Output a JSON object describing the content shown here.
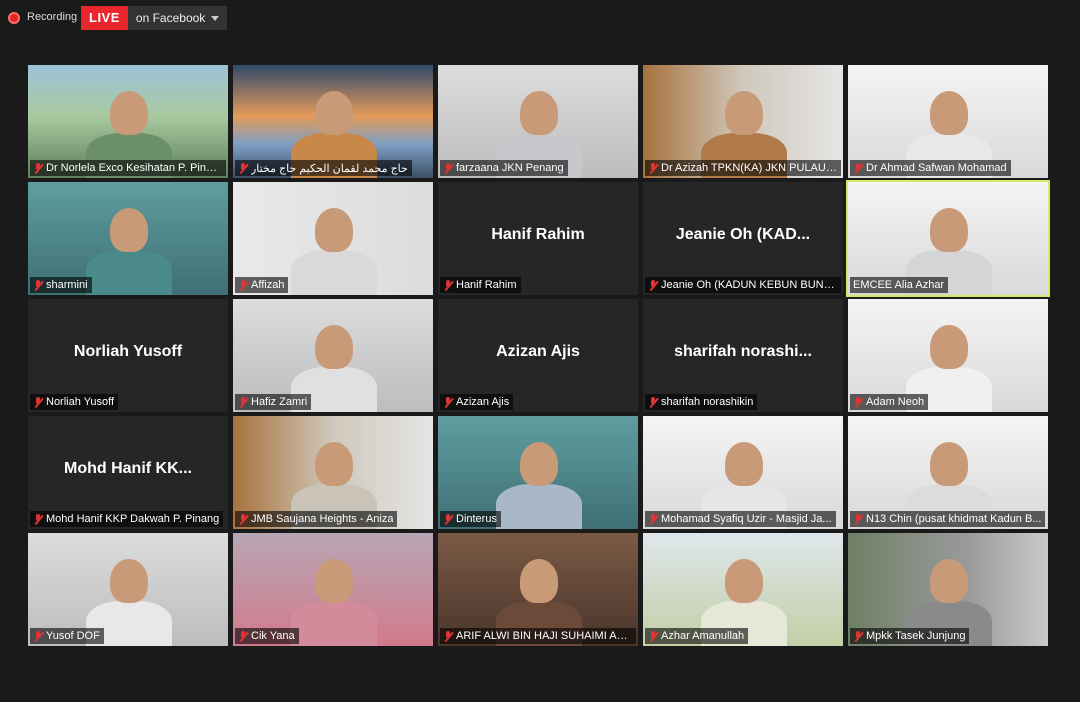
{
  "recording": {
    "label": "Recording"
  },
  "live": {
    "badge": "LIVE",
    "destination": "on Facebook"
  },
  "participants": [
    {
      "name": "Dr Norlela Exco Kesihatan P. Pinang",
      "big": "",
      "video": "outdoor",
      "accent": "#6a8f6a"
    },
    {
      "name": "حاج محمد لقمان الحكيم حاج مختار",
      "big": "",
      "video": "mosque",
      "accent": "#c7884a"
    },
    {
      "name": "farzaana JKN Penang",
      "big": "",
      "video": "office",
      "accent": "#c8c8cc"
    },
    {
      "name": "Dr Azizah TPKN(KA) JKN PULAU PI...",
      "big": "",
      "video": "room",
      "accent": "#b07a4a"
    },
    {
      "name": "Dr Ahmad Safwan Mohamad",
      "big": "",
      "video": "white",
      "accent": "#e8e8e8"
    },
    {
      "name": "sharmini",
      "big": "",
      "video": "portrait",
      "accent": "#4a8a8a"
    },
    {
      "name": "Affizah",
      "big": "",
      "video": "poster",
      "accent": "#d9d9d9"
    },
    {
      "name": "Hanif Rahim",
      "big": "Hanif Rahim",
      "video": "",
      "accent": ""
    },
    {
      "name": "Jeanie Oh (KADUN KEBUN BUNGA)",
      "big": "Jeanie  Oh  (KAD...",
      "video": "",
      "accent": ""
    },
    {
      "name": "EMCEE Alia Azhar",
      "big": "",
      "video": "white",
      "accent": "#d5d5d5",
      "active": true
    },
    {
      "name": "Norliah Yusoff",
      "big": "Norliah Yusoff",
      "video": "",
      "accent": ""
    },
    {
      "name": "Hafiz Zamri",
      "big": "",
      "video": "office",
      "accent": "#e0e0e0"
    },
    {
      "name": "Azizan Ajis",
      "big": "Azizan Ajis",
      "video": "",
      "accent": ""
    },
    {
      "name": "sharifah norashikin",
      "big": "sharifah  norashi...",
      "video": "",
      "accent": ""
    },
    {
      "name": "Adam Neoh",
      "big": "",
      "video": "white",
      "accent": "#f0f0f0"
    },
    {
      "name": "Mohd Hanif KKP Dakwah P. Pinang",
      "big": "Mohd  Hanif  KK...",
      "video": "",
      "accent": ""
    },
    {
      "name": "JMB Saujana Heights - Aniza",
      "big": "",
      "video": "room",
      "accent": "#c9c3b8"
    },
    {
      "name": "Dinterus",
      "big": "",
      "video": "portrait",
      "accent": "#a8b8c8"
    },
    {
      "name": "Mohamad Syafiq Uzir - Masjid Ja...",
      "big": "",
      "video": "white",
      "accent": "#e6e6e6"
    },
    {
      "name": "N13 Chin (pusat khidmat Kadun B...",
      "big": "",
      "video": "white",
      "accent": "#dcdcdc"
    },
    {
      "name": "Yusof DOF",
      "big": "",
      "video": "office",
      "accent": "#e8e8e8"
    },
    {
      "name": "Cik Yana",
      "big": "",
      "video": "pink",
      "accent": "#d38a9a"
    },
    {
      "name": "ARIF ALWI BIN HAJI SUHAIMI ARI...",
      "big": "",
      "video": "books",
      "accent": "#6b4a3a"
    },
    {
      "name": "Azhar Amanullah",
      "big": "",
      "video": "green",
      "accent": "#e8e8d8"
    },
    {
      "name": "Mpkk Tasek Junjung",
      "big": "",
      "video": "car",
      "accent": "#8a8a8a"
    }
  ]
}
